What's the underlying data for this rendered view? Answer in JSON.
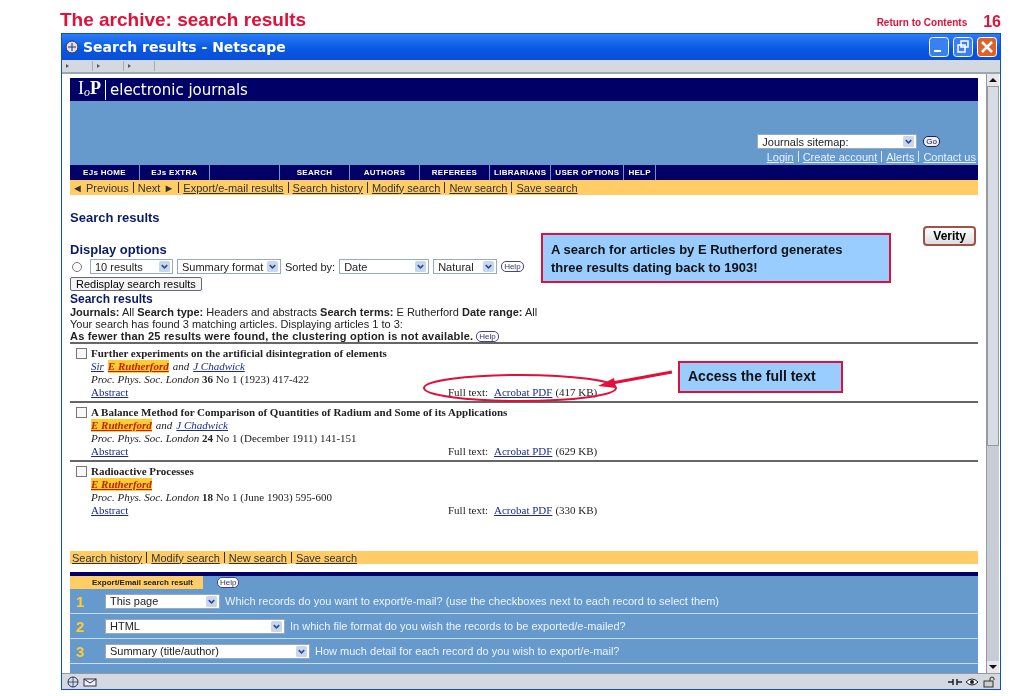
{
  "slide": {
    "title": "The archive: search results",
    "return_prefix": "Return to",
    "return_link": "Contents",
    "page_number": "16"
  },
  "window": {
    "title": "Search results - Netscape"
  },
  "site": {
    "logo": "I$_{o}$**P**",
    "name": "electronic journals",
    "sitemap": {
      "placeholder": "Journals sitemap:",
      "go": "Go"
    },
    "account_links": [
      "Login",
      "Create account",
      "Alerts",
      "Contact us"
    ],
    "nav": [
      {
        "kind": "link",
        "label": "EJs HOME"
      },
      {
        "kind": "link",
        "label": "EJs EXTRA"
      },
      {
        "kind": "spacer"
      },
      {
        "kind": "link",
        "label": "SEARCH"
      },
      {
        "kind": "link",
        "label": "AUTHORS"
      },
      {
        "kind": "link",
        "label": "REFEREES"
      },
      {
        "kind": "link",
        "label": "LIBRARIANS"
      },
      {
        "kind": "link",
        "label": "USER OPTIONS"
      },
      {
        "kind": "link",
        "label": "HELP"
      }
    ]
  },
  "top_links": [
    {
      "kind": "plain",
      "label": "◄ Previous"
    },
    {
      "kind": "plain",
      "label": "Next ►"
    },
    {
      "kind": "link",
      "label": "Export/e-mail results"
    },
    {
      "kind": "link",
      "label": "Search history"
    },
    {
      "kind": "link",
      "label": "Modify search"
    },
    {
      "kind": "link",
      "label": "New search"
    },
    {
      "kind": "link",
      "label": "Save search"
    }
  ],
  "heading": "Search results",
  "verity_button": "Verity",
  "display_options": {
    "title": "Display options",
    "radio": {
      "selected": false
    },
    "count": "10 results",
    "format": "Summary format",
    "sorted_label": "Sorted by:",
    "sort": "Date",
    "order": "Natural",
    "help": "Help",
    "redisplay": "Redisplay search results"
  },
  "results_heading": "Search results",
  "summary": "**Journals:** All **Search type:** Headers and abstracts **Search terms:** E Rutherford **Date range:** All",
  "found": "Your search has found 3 matching articles. Displaying articles 1 to 3:",
  "notice": "As fewer than 25 results were found, the clustering option is not available.",
  "notice_help": "Help",
  "results": [
    {
      "checked": false,
      "title": "Further experiments on the artificial disintegration of elements",
      "authors": [
        {
          "kind": "link",
          "text": "Sir"
        },
        {
          "kind": "highlight",
          "text": "E Rutherford"
        },
        {
          "kind": "plain",
          "text": "and"
        },
        {
          "kind": "link",
          "text": "J Chadwick"
        }
      ],
      "citation": "*Proc. Phys. Soc. London* **36** No 1 (1923) 417-422",
      "abstract": "Abstract",
      "full_text_label": "Full text:",
      "pdf": "Acrobat PDF",
      "size": "(417 KB)"
    },
    {
      "checked": false,
      "title": "A Balance Method for Comparison of Quantities of Radium and Some of its Applications",
      "authors": [
        {
          "kind": "highlight",
          "text": "E Rutherford"
        },
        {
          "kind": "plain",
          "text": "and"
        },
        {
          "kind": "link",
          "text": "J Chadwick"
        }
      ],
      "citation": "*Proc. Phys. Soc. London* **24** No 1 (December 1911) 141-151",
      "abstract": "Abstract",
      "full_text_label": "Full text:",
      "pdf": "Acrobat PDF",
      "size": "(629 KB)"
    },
    {
      "checked": false,
      "title": "Radioactive Processes",
      "authors": [
        {
          "kind": "highlight",
          "text": "E Rutherford"
        }
      ],
      "citation": "*Proc. Phys. Soc. London* **18** No 1 (June 1903) 595-600",
      "abstract": "Abstract",
      "full_text_label": "Full text:",
      "pdf": "Acrobat PDF",
      "size": "(330 KB)"
    }
  ],
  "bottom_links": [
    "Search history",
    "Modify search",
    "New search",
    "Save search"
  ],
  "export": {
    "title": "Export/Email search result",
    "help": "Help",
    "rows": [
      {
        "number": "1",
        "value": "This page",
        "question": "Which records do you want to export/e-mail? (use the checkboxes next to each record to select them)"
      },
      {
        "number": "2",
        "value": "HTML",
        "question": "In which file format do you wish the records to be exported/e-mailed?"
      },
      {
        "number": "3",
        "value": "Summary (title/author)",
        "question": "How much detail for each record do you wish to export/e-mail?"
      }
    ]
  },
  "callouts": [
    {
      "text": "A search for articles by E Rutherford generates three results dating back to 1903!"
    },
    {
      "text": "Access the full text"
    }
  ]
}
